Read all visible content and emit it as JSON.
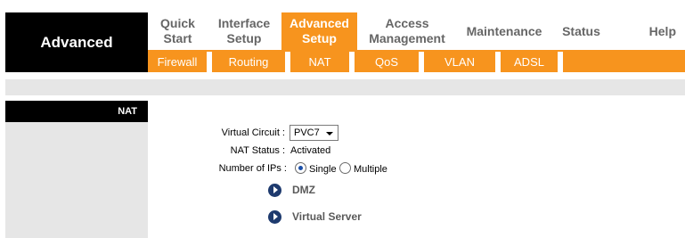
{
  "section_title": "Advanced",
  "main_nav": [
    {
      "label": "Quick\nStart"
    },
    {
      "label": "Interface\nSetup"
    },
    {
      "label": "Advanced\nSetup"
    },
    {
      "label": "Access\nManagement"
    },
    {
      "label": "Maintenance"
    },
    {
      "label": "Status"
    },
    {
      "label": "Help"
    }
  ],
  "sub_nav": [
    {
      "label": "Firewall"
    },
    {
      "label": "Routing"
    },
    {
      "label": "NAT"
    },
    {
      "label": "QoS"
    },
    {
      "label": "VLAN"
    },
    {
      "label": "ADSL"
    }
  ],
  "sidebar_label": "NAT",
  "form": {
    "virtual_circuit_label": "Virtual Circuit :",
    "virtual_circuit_value": "PVC7",
    "nat_status_label": "NAT Status :",
    "nat_status_value": "Activated",
    "number_of_ips_label": "Number of IPs :",
    "single_label": "Single",
    "multiple_label": "Multiple",
    "selected_ips": "Single"
  },
  "links": {
    "dmz": "DMZ",
    "virtual_server": "Virtual Server"
  },
  "colors": {
    "accent": "#f7941e",
    "header_bg": "#000000",
    "panel_grey": "#e6e6e6",
    "link_icon": "#1e3a6e"
  }
}
